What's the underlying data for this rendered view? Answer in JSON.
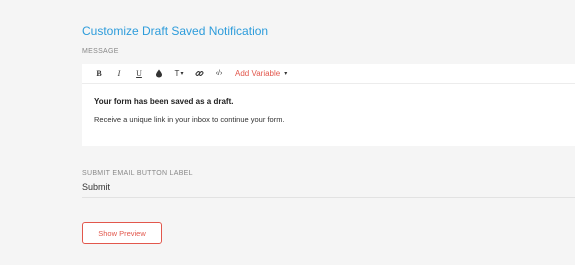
{
  "title": "Customize Draft Saved Notification",
  "message_section": {
    "label": "MESSAGE",
    "toolbar": {
      "bold": "B",
      "italic": "I",
      "underline": "U",
      "text_size": "T",
      "text_size_caret": "▾",
      "code": "‹/›",
      "add_variable": "Add Variable",
      "add_variable_caret": "▾"
    },
    "content": {
      "heading": "Your form has been saved as a draft.",
      "body": "Receive a unique link in your inbox to continue your form."
    }
  },
  "submit_section": {
    "label": "SUBMIT EMAIL BUTTON LABEL",
    "value": "Submit"
  },
  "show_preview_button": "Show Preview",
  "colors": {
    "title": "#2d9cdb",
    "accent": "#e2574c",
    "background": "#f5f5f5"
  }
}
